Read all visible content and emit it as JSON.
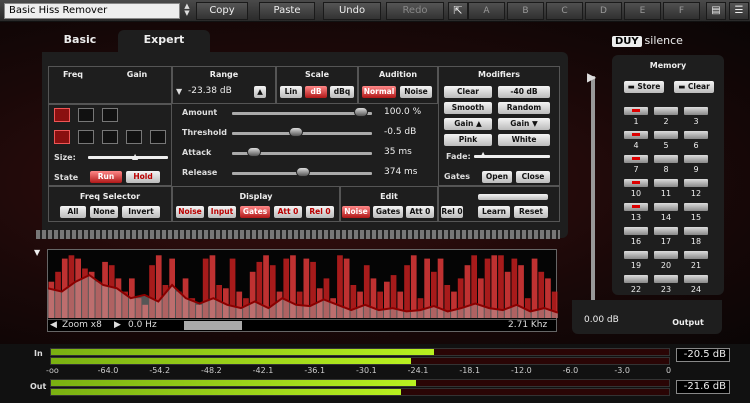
{
  "toolbar": {
    "preset": "Basic Hiss Remover",
    "copy": "Copy",
    "paste": "Paste",
    "undo": "Undo",
    "redo": "Redo",
    "slots": [
      "A",
      "B",
      "C",
      "D",
      "E",
      "F"
    ]
  },
  "tabs": {
    "basic": "Basic",
    "expert": "Expert"
  },
  "logo": {
    "brand": "DUY",
    "product": "silence"
  },
  "headers": {
    "freq": "Freq",
    "gain": "Gain",
    "range": "Range",
    "scale": "Scale",
    "audition": "Audition",
    "modifiers": "Modifiers",
    "freq_selector": "Freq Selector",
    "display": "Display",
    "edit": "Edit",
    "memory": "Memory",
    "gates": "Gates",
    "fade": "Fade:",
    "size": "Size:",
    "state": "State"
  },
  "range": {
    "value": "-23.38 dB"
  },
  "scale": [
    "Lin",
    "dB",
    "dBq"
  ],
  "audition": [
    "Normal",
    "Noise"
  ],
  "modifiers": {
    "clear": "Clear",
    "minus40": "-40 dB",
    "smooth": "Smooth",
    "random": "Random",
    "gain_up": "Gain",
    "gain_down": "Gain",
    "pink": "Pink",
    "white": "White",
    "open": "Open",
    "close": "Close"
  },
  "state": {
    "run": "Run",
    "hold": "Hold"
  },
  "sliders": [
    {
      "label": "Amount",
      "value": "100.0 %",
      "pos": 0.95
    },
    {
      "label": "Threshold",
      "value": "-0.5 dB",
      "pos": 0.47
    },
    {
      "label": "Attack",
      "value": "35 ms",
      "pos": 0.16
    },
    {
      "label": "Release",
      "value": "374 ms",
      "pos": 0.52
    }
  ],
  "freq_selector": [
    "All",
    "None",
    "Invert"
  ],
  "display": [
    "Noise",
    "Input",
    "Gates",
    "Att 0",
    "Rel 0"
  ],
  "edit": [
    "Noise",
    "Gates",
    "Att 0",
    "Rel 0"
  ],
  "learn": {
    "learn": "Learn",
    "reset": "Reset"
  },
  "memory": {
    "store": "Store",
    "clear": "Clear",
    "numbers": [
      "1",
      "2",
      "3",
      "4",
      "5",
      "6",
      "7",
      "8",
      "9",
      "10",
      "11",
      "12",
      "13",
      "14",
      "15",
      "16",
      "17",
      "18",
      "19",
      "20",
      "21",
      "22",
      "23",
      "24"
    ],
    "active": [
      1,
      4,
      7,
      10,
      13
    ]
  },
  "output": {
    "value": "0.00 dB",
    "label": "Output"
  },
  "graph": {
    "zoom": "Zoom x8",
    "freq_start": "0.0 Hz",
    "freq_end": "2.71 Khz",
    "bars": [
      0.55,
      0.7,
      0.9,
      0.95,
      0.9,
      0.75,
      0.7,
      0.55,
      0.85,
      0.8,
      0.6,
      0.4,
      0.6,
      0.3,
      0.2,
      0.8,
      0.95,
      0.5,
      0.9,
      0.4,
      0.6,
      0.3,
      0.2,
      0.9,
      0.95,
      0.5,
      0.45,
      0.9,
      0.4,
      0.3,
      0.7,
      0.85,
      0.95,
      0.8,
      0.4,
      0.9,
      0.95,
      0.4,
      0.9,
      0.85,
      0.45,
      0.6,
      0.3,
      0.95,
      0.9,
      0.5,
      0.4,
      0.8,
      0.6,
      0.4,
      0.55,
      0.65,
      0.4,
      0.8,
      0.95,
      0.3,
      0.9,
      0.7,
      0.9,
      0.5,
      0.4,
      0.6,
      0.8,
      0.95,
      0.6,
      0.9,
      0.95,
      0.95,
      0.7,
      0.9,
      0.8,
      0.3,
      0.9,
      0.7,
      0.6,
      0.4
    ],
    "curve": [
      0.45,
      0.4,
      0.55,
      0.65,
      0.5,
      0.45,
      0.3,
      0.35,
      0.25,
      0.5,
      0.3,
      0.22,
      0.3,
      0.2,
      0.15,
      0.25,
      0.15,
      0.3,
      0.2,
      0.18,
      0.28,
      0.2,
      0.12,
      0.2,
      0.12,
      0.15,
      0.1,
      0.12,
      0.18,
      0.1,
      0.15,
      0.22,
      0.15,
      0.12,
      0.2,
      0.1,
      0.15,
      0.08
    ]
  },
  "meters": {
    "in_label": "In",
    "out_label": "Out",
    "in_value": "-20.5 dB",
    "out_value": "-21.6 dB",
    "in_level": 0.62,
    "out_level": 0.59,
    "scale": [
      "-oo",
      "-64.0",
      "-54.2",
      "-48.2",
      "-42.1",
      "-36.1",
      "-30.1",
      "-24.1",
      "-18.1",
      "-12.0",
      "-6.0",
      "-3.0",
      "0"
    ]
  },
  "colors": {
    "accent": "#c01818",
    "meter_green": "#9ce01a",
    "panel": "#1e1e1e"
  }
}
